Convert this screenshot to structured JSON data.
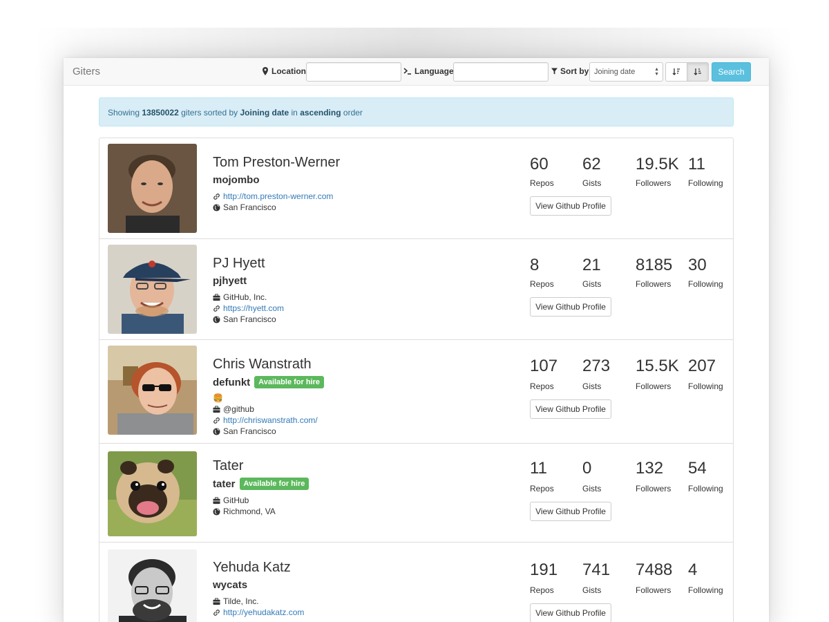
{
  "app": {
    "brand": "Giters"
  },
  "navbar": {
    "location_label": "Location",
    "location_value": "",
    "language_label": "Language",
    "language_value": "",
    "sortby_label": "Sort by",
    "sort_selected": "Joining date",
    "sort_desc_icon": "sort-desc-icon",
    "sort_asc_icon": "sort-asc-icon",
    "search_label": "Search"
  },
  "alert": {
    "prefix": "Showing",
    "count": "13850022",
    "middle": "giters sorted by",
    "sort_field": "Joining date",
    "in": "in",
    "order": "ascending",
    "suffix": "order"
  },
  "labels": {
    "repos": "Repos",
    "gists": "Gists",
    "followers": "Followers",
    "following": "Following",
    "view_profile": "View Github Profile",
    "hire": "Available for hire"
  },
  "users": [
    {
      "name": "Tom Preston-Werner",
      "login": "mojombo",
      "hireable": false,
      "emoji": "",
      "company": "",
      "blog": "http://tom.preston-werner.com",
      "location": "San Francisco",
      "repos": "60",
      "gists": "62",
      "followers": "19.5K",
      "following": "11"
    },
    {
      "name": "PJ Hyett",
      "login": "pjhyett",
      "hireable": false,
      "emoji": "",
      "company": "GitHub, Inc.",
      "blog": "https://hyett.com",
      "location": "San Francisco",
      "repos": "8",
      "gists": "21",
      "followers": "8185",
      "following": "30"
    },
    {
      "name": "Chris Wanstrath",
      "login": "defunkt",
      "hireable": true,
      "emoji": "🍔",
      "company": "@github",
      "blog": "http://chriswanstrath.com/",
      "location": "San Francisco",
      "repos": "107",
      "gists": "273",
      "followers": "15.5K",
      "following": "207"
    },
    {
      "name": "Tater",
      "login": "tater",
      "hireable": true,
      "emoji": "",
      "company": "GitHub",
      "blog": "",
      "location": "Richmond, VA",
      "repos": "11",
      "gists": "0",
      "followers": "132",
      "following": "54"
    },
    {
      "name": "Yehuda Katz",
      "login": "wycats",
      "hireable": false,
      "emoji": "",
      "company": "Tilde, Inc.",
      "blog": "http://yehudakatz.com",
      "location": "",
      "repos": "191",
      "gists": "741",
      "followers": "7488",
      "following": "4"
    }
  ],
  "colors": {
    "info_bg": "#d9edf7",
    "hire_green": "#5cb85c",
    "search_btn": "#5bc0de",
    "link": "#337ab7"
  }
}
